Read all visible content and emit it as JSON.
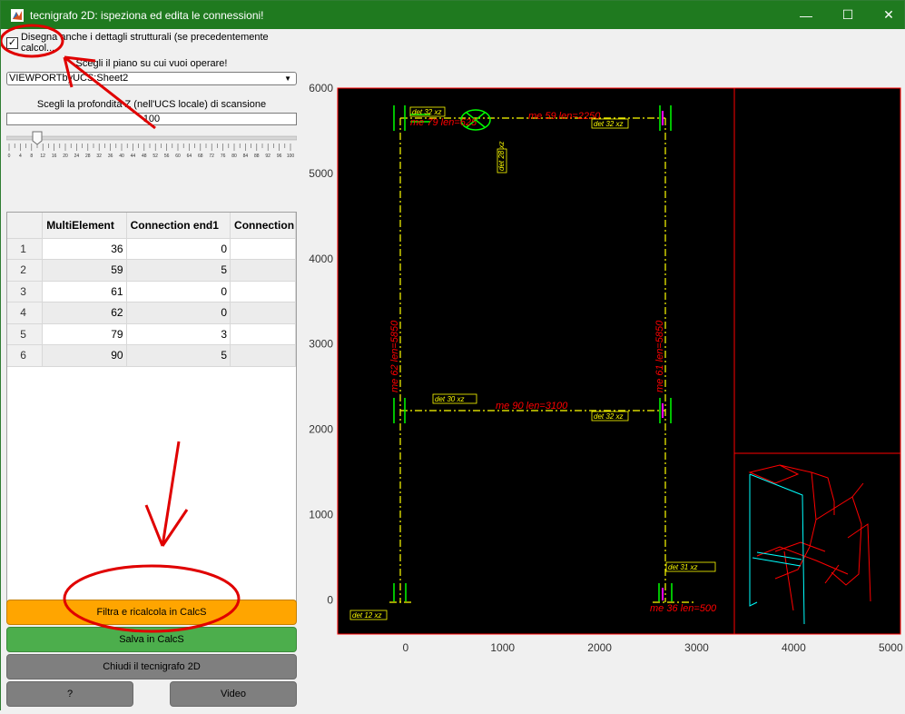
{
  "window": {
    "title": "tecnigrafo 2D: ispeziona ed edita le connessioni!",
    "minimize": "—",
    "maximize": "☐",
    "close": "✕"
  },
  "controls": {
    "checkbox_label": "Disegna anche i dettagli strutturali (se precedentemente calcol...",
    "checkbox_checked": true,
    "plane_label": "Scegli il piano su cui vuoi operare!",
    "plane_value": "VIEWPORTbyUCS:Sheet2",
    "depth_label": "Scegli la profondita Z (nell'UCS locale) di scansione",
    "depth_value": "100",
    "slider_value": 10,
    "slider_max": 100,
    "slider_ticks": [
      "0",
      "4",
      "8",
      "12",
      "16",
      "20",
      "24",
      "28",
      "32",
      "36",
      "40",
      "44",
      "48",
      "52",
      "56",
      "60",
      "64",
      "68",
      "72",
      "76",
      "80",
      "84",
      "88",
      "92",
      "96",
      "100"
    ]
  },
  "table": {
    "columns": [
      "",
      "MultiElement",
      "Connection end1",
      "Connection"
    ],
    "rows": [
      [
        "1",
        "36",
        "0",
        ""
      ],
      [
        "2",
        "59",
        "5",
        ""
      ],
      [
        "3",
        "61",
        "0",
        ""
      ],
      [
        "4",
        "62",
        "0",
        ""
      ],
      [
        "5",
        "79",
        "3",
        ""
      ],
      [
        "6",
        "90",
        "5",
        ""
      ]
    ]
  },
  "buttons": {
    "filter": "Filtra e ricalcola in CalcS",
    "save": "Salva in CalcS",
    "close": "Chiudi il tecnigrafo 2D",
    "help": "?",
    "video": "Video"
  },
  "chart_data": {
    "type": "drawing",
    "xlim": [
      -700,
      3900
    ],
    "ylim": [
      -400,
      6000
    ],
    "xticks": [
      "0",
      "1000",
      "2000",
      "3000",
      "4000",
      "5000"
    ],
    "yticks": [
      "0",
      "1000",
      "2000",
      "3000",
      "4000",
      "5000",
      "6000"
    ],
    "colors": {
      "background": "#000000",
      "member": "#ffff00",
      "label": "#ff0000",
      "frame": "#ff0000",
      "connection": "#00ff00",
      "iso_cyan": "#00ffff"
    },
    "labels": [
      "me 59 len=2250",
      "me 62 len=5850",
      "me 61 len=5850",
      "me 90 len=3100",
      "me 36 len=500",
      "me 79 len=625"
    ],
    "yellow_tags": [
      "det 32 xz",
      "det 32 xz",
      "det 28 xz",
      "det 30 xz",
      "det 31 xz",
      "det 32 xz",
      "det 31 xz",
      "det 12 xz"
    ]
  }
}
